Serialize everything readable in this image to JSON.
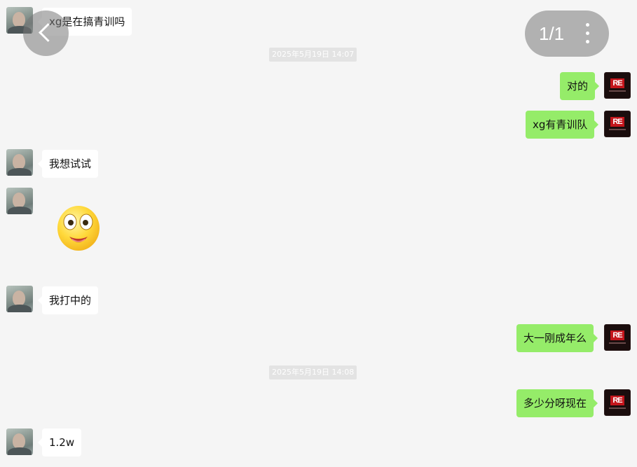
{
  "viewer": {
    "page_counter": "1/1"
  },
  "timestamps": [
    "2025年5月19日 14:07",
    "2025年5月19日 14:08"
  ],
  "messages": [
    {
      "sender": "peer",
      "text": "xg是在搞青训吗"
    },
    {
      "sender": "self",
      "text": "对的"
    },
    {
      "sender": "self",
      "text": "xg有青训队"
    },
    {
      "sender": "peer",
      "text": "我想试试"
    },
    {
      "sender": "peer",
      "type": "sticker",
      "sticker": "shocked-face-emoji"
    },
    {
      "sender": "peer",
      "text": "我打中的"
    },
    {
      "sender": "self",
      "text": "大一刚成年么"
    },
    {
      "sender": "self",
      "text": "多少分呀现在"
    },
    {
      "sender": "peer",
      "text": "1.2w"
    }
  ],
  "self_avatar": {
    "logo_text": "RE"
  },
  "colors": {
    "background": "#f5f5f5",
    "self_bubble": "#95ec69",
    "peer_bubble": "#ffffff",
    "logo_red": "#c4161c"
  }
}
